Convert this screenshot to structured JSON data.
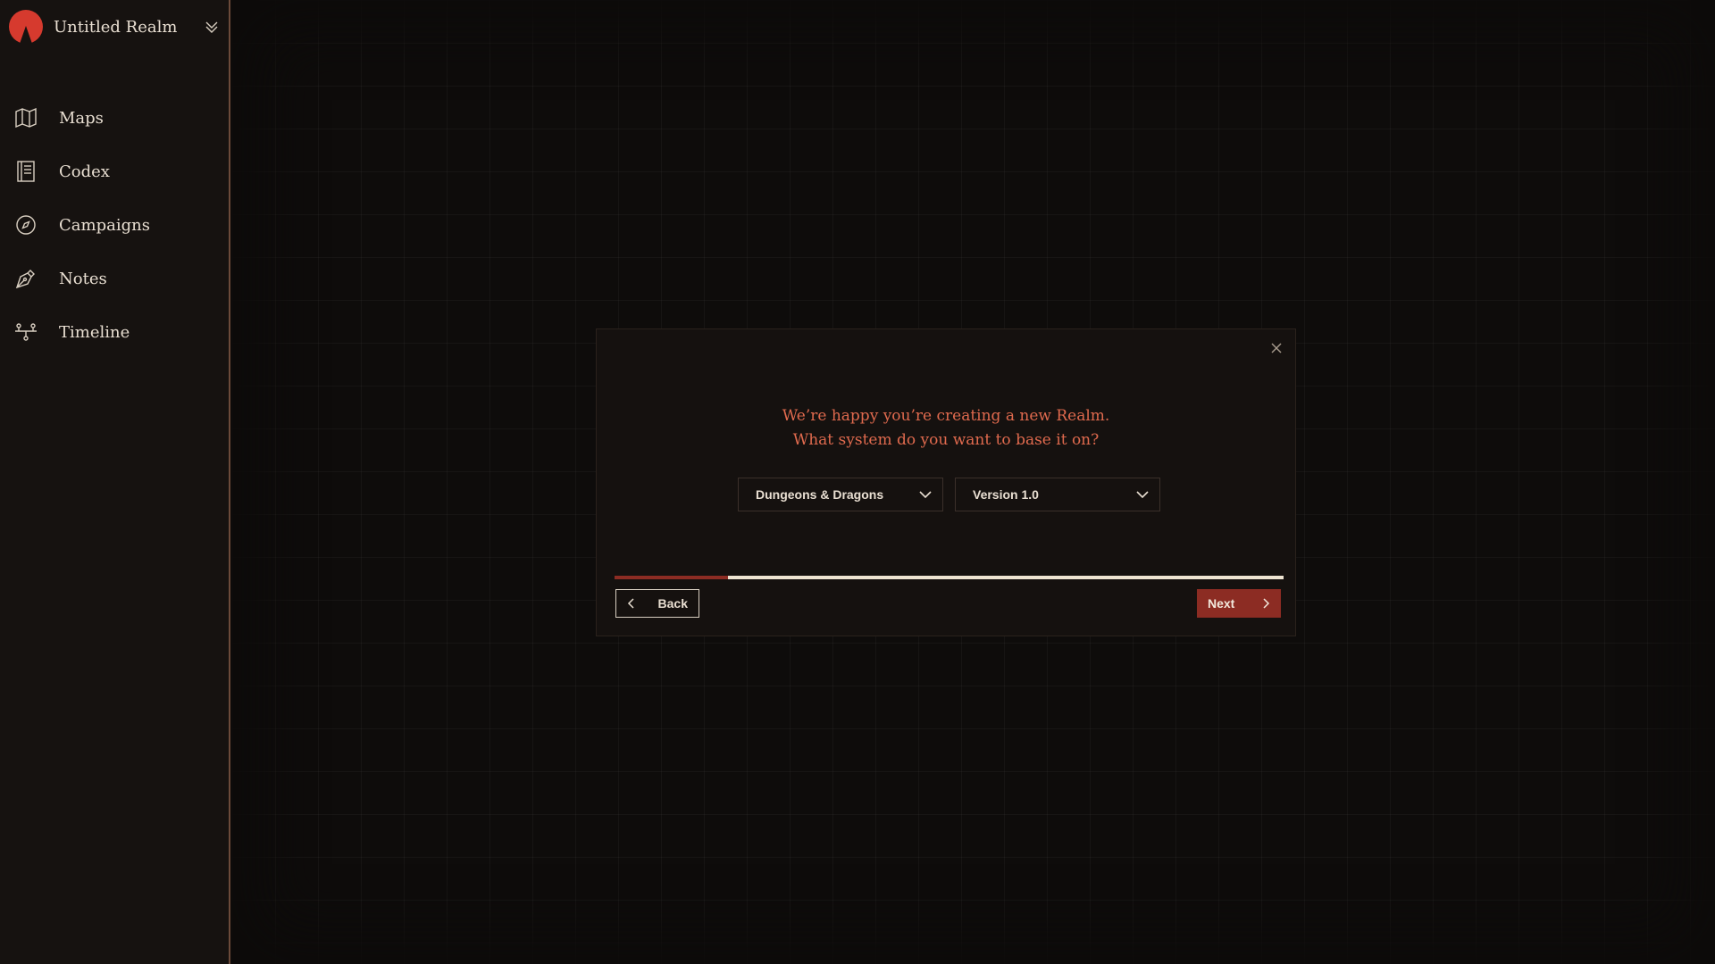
{
  "sidebar": {
    "realm_name": "Untitled Realm",
    "logo_icon": "realm-logo-icon",
    "switcher_icon": "chevron-double-down-icon",
    "items": [
      {
        "label": "Maps",
        "icon": "map-icon"
      },
      {
        "label": "Codex",
        "icon": "book-icon"
      },
      {
        "label": "Campaigns",
        "icon": "compass-icon"
      },
      {
        "label": "Notes",
        "icon": "pen-nib-icon"
      },
      {
        "label": "Timeline",
        "icon": "timeline-icon"
      }
    ]
  },
  "modal": {
    "prompt_line1": "We’re happy you’re creating a new Realm.",
    "prompt_line2": "What system do you want to base it on?",
    "system_select": {
      "value": "Dungeons & Dragons"
    },
    "version_select": {
      "value": "Version 1.0"
    },
    "progress_fraction": 0.17,
    "back_label": "Back",
    "next_label": "Next",
    "close_icon": "close-icon"
  },
  "colors": {
    "accent": "#8c2c23",
    "prompt_text": "#e06a4e",
    "background": "#0d0b0a",
    "sidebar_border": "#6b4a3a"
  }
}
